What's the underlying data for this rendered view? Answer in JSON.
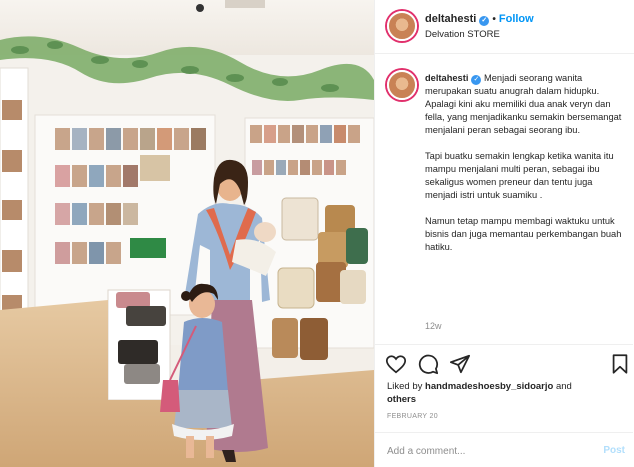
{
  "post": {
    "username": "deltahesti",
    "verified": true,
    "follow_label": "Follow",
    "location": "Delvation STORE",
    "caption_paragraphs": [
      "Menjadi seorang wanita merupakan suatu anugrah dalam hidupku. Apalagi kini aku memiliki dua anak veryn dan fella, yang menjadikanku semakin bersemangat menjalani peran sebagai seorang ibu.",
      "Tapi buatku semakin lengkap ketika wanita itu mampu menjalani multi peran, sebagai ibu sekaligus women preneur dan tentu juga menjadi istri untuk suamiku .",
      "Namun tetap mampu membagi waktuku untuk bisnis dan juga memantau perkembangan buah hatiku."
    ],
    "time_ago": "12w",
    "likes_prefix": "Liked by",
    "liked_by_user": "handmadeshoesby_sidoarjo",
    "likes_connector": "and",
    "likes_others": "others",
    "date": "FEBRUARY 20"
  },
  "actions": {
    "like_icon": "heart-icon",
    "comment_icon": "comment-icon",
    "share_icon": "share-icon",
    "save_icon": "bookmark-icon"
  },
  "comment_box": {
    "placeholder": "Add a comment...",
    "post_label": "Post"
  },
  "colors": {
    "link": "#0095f6",
    "verified": "#3897f0",
    "muted": "#8e8e8e",
    "post_disabled": "#b2dffc",
    "story_ring": "#e1306c"
  }
}
